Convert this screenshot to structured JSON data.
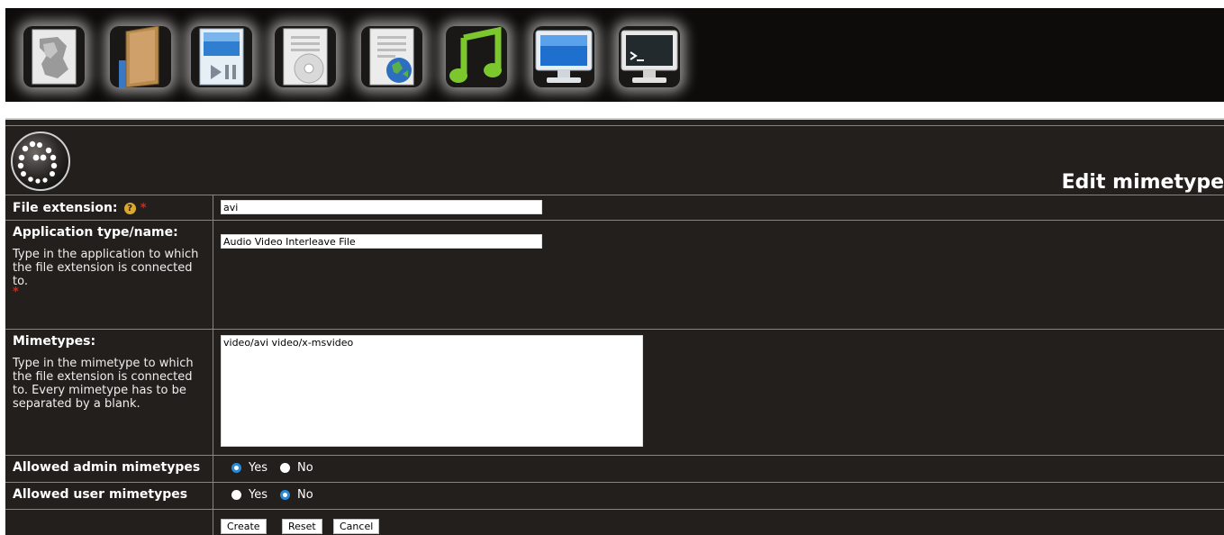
{
  "toolbar": {
    "icons": [
      {
        "name": "map-icon"
      },
      {
        "name": "file-manager-icon"
      },
      {
        "name": "media-player-icon"
      },
      {
        "name": "cd-burner-icon"
      },
      {
        "name": "web-document-icon"
      },
      {
        "name": "music-icon"
      },
      {
        "name": "display-icon"
      },
      {
        "name": "terminal-icon"
      }
    ]
  },
  "page": {
    "title": "Edit mimetype"
  },
  "form": {
    "file_extension": {
      "label": "File extension:",
      "required_mark": "*",
      "help_icon": "?",
      "value": "avi"
    },
    "application_type": {
      "label": "Application type/name:",
      "description": "Type in the application to which the file extension is connected to.",
      "required_mark": "*",
      "value": "Audio Video Interleave File"
    },
    "mimetypes": {
      "label": "Mimetypes:",
      "description": "Type in the mimetype to which the file extension is connected to. Every mimetype has to be separated by a blank.",
      "value": "video/avi video/x-msvideo"
    },
    "allowed_admin": {
      "label": "Allowed admin mimetypes",
      "options": [
        "Yes",
        "No"
      ],
      "selected": "Yes"
    },
    "allowed_user": {
      "label": "Allowed user mimetypes",
      "options": [
        "Yes",
        "No"
      ],
      "selected": "No"
    },
    "buttons": {
      "create": "Create",
      "reset": "Reset",
      "cancel": "Cancel"
    }
  },
  "colors": {
    "panel_bg": "#231f1d",
    "toolbar_bg": "#0e0c0b",
    "accent_blue": "#2a8ad8",
    "required_red": "#e3231b"
  }
}
